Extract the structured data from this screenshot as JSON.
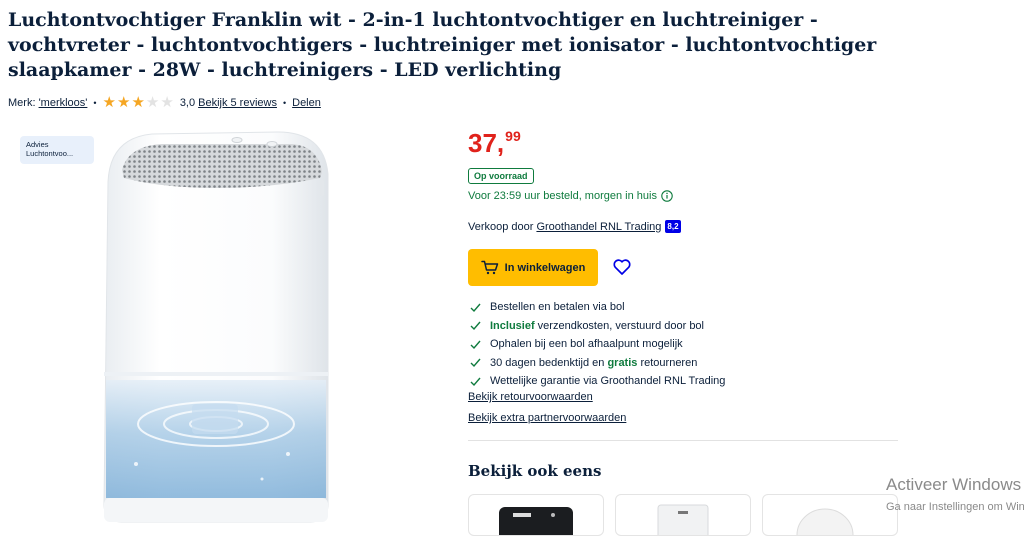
{
  "product": {
    "title": "Luchtontvochtiger Franklin wit - 2-in-1 luchtontvochtiger en luchtreiniger - vochtvreter - luchtontvochtigers - luchtreiniger met ionisator - luchtontvochtiger slaapkamer - 28W - luchtreinigers - LED verlichting"
  },
  "meta": {
    "brand_label": "Merk:",
    "brand_link": "'merkloos'",
    "rating_stars": 3,
    "rating_max": 5,
    "rating_value": "3,0",
    "reviews_link": "Bekijk 5 reviews",
    "share_link": "Delen"
  },
  "badge": {
    "line1": "Advies",
    "line2": "Luchtontvoo..."
  },
  "price": {
    "whole": "37,",
    "cents": "99"
  },
  "stock_label": "Op voorraad",
  "delivery_text": "Voor 23:59 uur besteld, morgen in huis",
  "seller": {
    "prefix": "Verkoop door",
    "name": "Groothandel RNL Trading",
    "score": "8,2"
  },
  "cart_button_label": "In winkelwagen",
  "usps": {
    "u1": "Bestellen en betalen via bol",
    "u2_bold": "Inclusief",
    "u2_rest": " verzendkosten, verstuurd door bol",
    "u3": "Ophalen bij een bol afhaalpunt mogelijk",
    "u4_pre": "30 dagen bedenktijd en ",
    "u4_bold": "gratis",
    "u4_post": " retourneren",
    "u5": "Wettelijke garantie via Groothandel RNL Trading"
  },
  "links": {
    "return_conditions": "Bekijk retourvoorwaarden",
    "partner_conditions": "Bekijk extra partnervoorwaarden"
  },
  "see_also_title": "Bekijk ook eens",
  "windows_activation": {
    "line1": "Activeer Windows",
    "line2": "Ga naar Instellingen om Windows te activeren."
  },
  "colors": {
    "price": "#e0221b",
    "success": "#0f7b3e",
    "button": "#ffbd00",
    "star": "#f5a623",
    "score_badge": "#0000e6",
    "heart": "#0000e6"
  }
}
